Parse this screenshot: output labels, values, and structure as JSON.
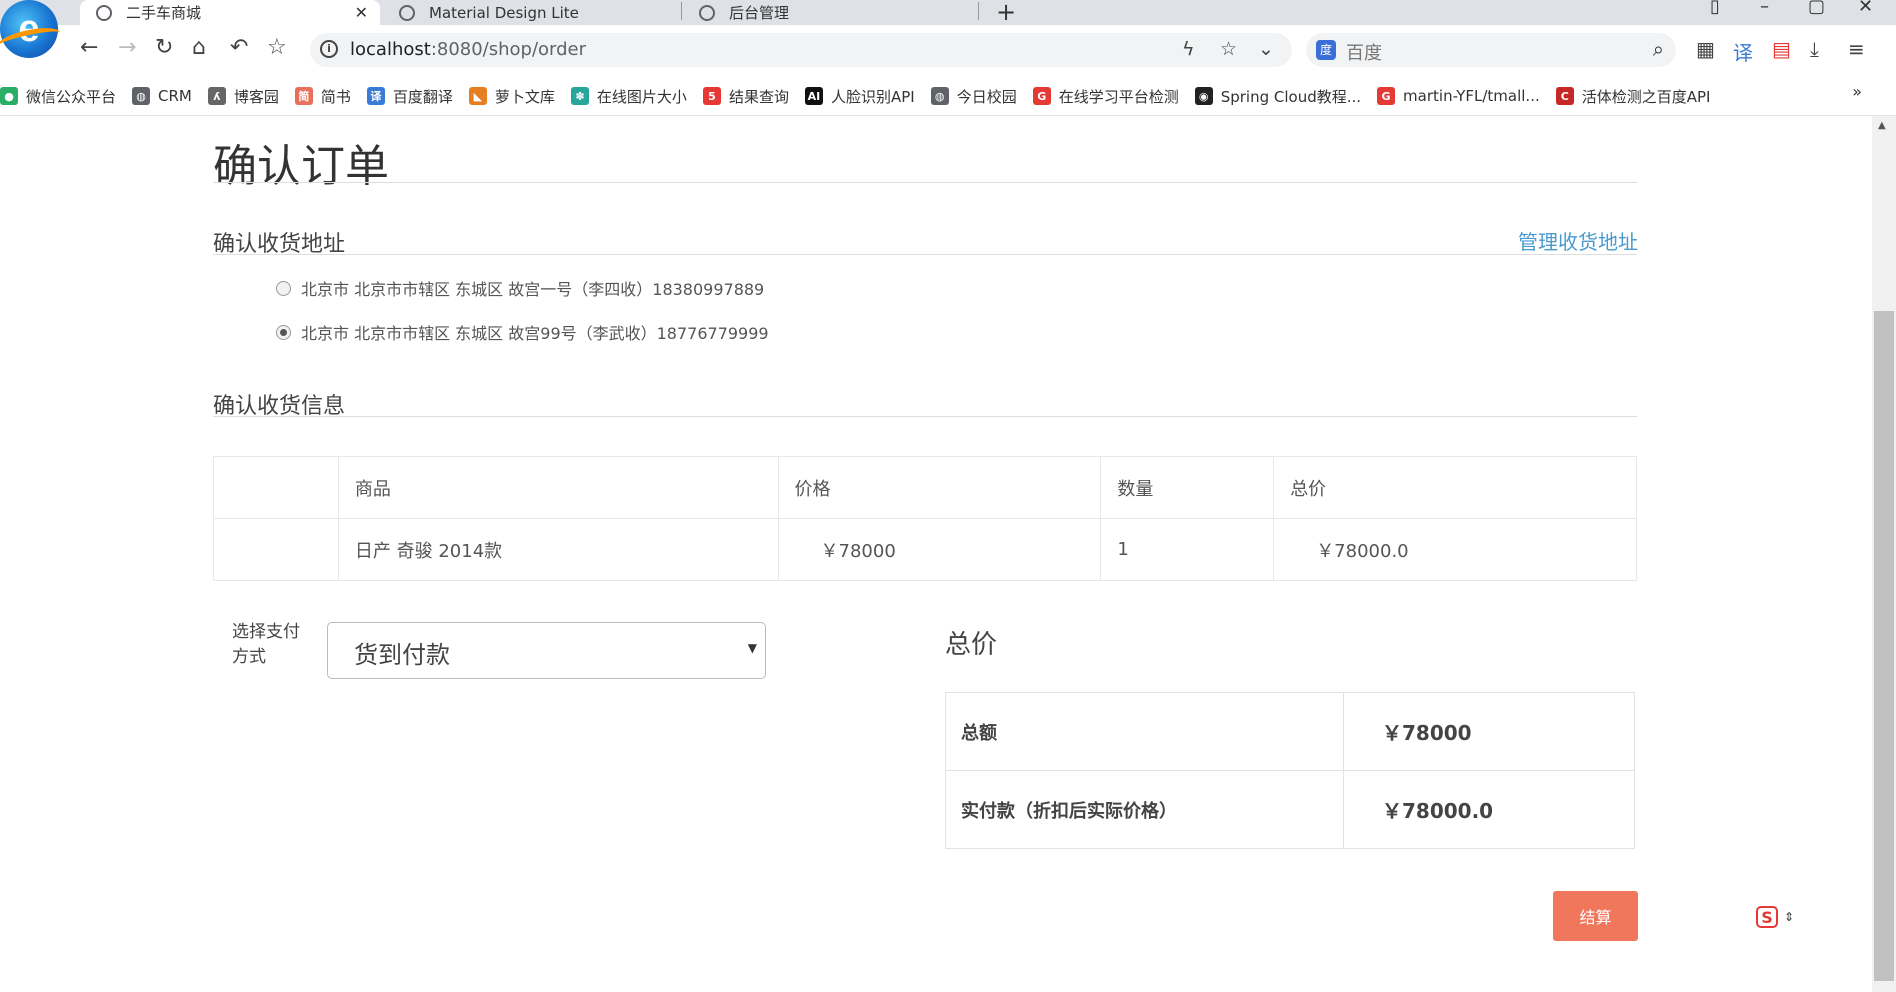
{
  "browser": {
    "tabs": [
      {
        "title": "二手车商城",
        "close": "✕"
      },
      {
        "title": "Material Design Lite"
      },
      {
        "title": "后台管理"
      }
    ],
    "new_tab": "+",
    "url_host": "localhost",
    "url_rest": ":8080/shop/order",
    "search_placeholder": "百度",
    "bookmarks": [
      {
        "label": "微信公众平台",
        "icon": "wechat-icon",
        "color": "#2aae67"
      },
      {
        "label": "CRM",
        "icon": "globe-icon",
        "color": "#5f6368"
      },
      {
        "label": "博客园",
        "icon": "blog-icon",
        "color": "#666666"
      },
      {
        "label": "简书",
        "icon": "jianshu-icon",
        "color": "#ea6f5a"
      },
      {
        "label": "百度翻译",
        "icon": "translate-icon",
        "color": "#3a7bd5"
      },
      {
        "label": "萝卜文库",
        "icon": "carrot-icon",
        "color": "#e67e22"
      },
      {
        "label": "在线图片大小",
        "icon": "gear-icon",
        "color": "#26a69a"
      },
      {
        "label": "结果查询",
        "icon": "five-icon",
        "color": "#e53935"
      },
      {
        "label": "人脸识别API",
        "icon": "ai-icon",
        "color": "#111111"
      },
      {
        "label": "今日校园",
        "icon": "globe-icon",
        "color": "#5f6368"
      },
      {
        "label": "在线学习平台检测",
        "icon": "g-icon",
        "color": "#e53935"
      },
      {
        "label": "Spring Cloud教程...",
        "icon": "github-icon",
        "color": "#222222"
      },
      {
        "label": "martin-YFL/tmall...",
        "icon": "g-icon",
        "color": "#e53935"
      },
      {
        "label": "活体检测之百度API",
        "icon": "c-icon",
        "color": "#c62828"
      }
    ],
    "bookmarks_more": "»"
  },
  "page": {
    "title": "确认订单",
    "address_section": "确认收货地址",
    "manage_link": "管理收货地址",
    "addresses": [
      {
        "text": "北京市 北京市市辖区 东城区 故宫一号（李四收）18380997889",
        "checked": false
      },
      {
        "text": "北京市 北京市市辖区 东城区 故宫99号（李武收）18776779999",
        "checked": true
      }
    ],
    "info_section": "确认收货信息",
    "table": {
      "headers": [
        "",
        "商品",
        "价格",
        "数量",
        "总价"
      ],
      "rows": [
        [
          "",
          "日产 奇骏 2014款",
          "￥78000",
          "1",
          "￥78000.0"
        ]
      ]
    },
    "payment": {
      "label": "选择支付方式",
      "selected": "货到付款"
    },
    "totals": {
      "heading": "总价",
      "rows": [
        {
          "label": "总额",
          "value": "￥78000"
        },
        {
          "label": "实付款（折扣后实际价格）",
          "value": "￥78000.0"
        }
      ]
    },
    "checkout_label": "结算"
  }
}
